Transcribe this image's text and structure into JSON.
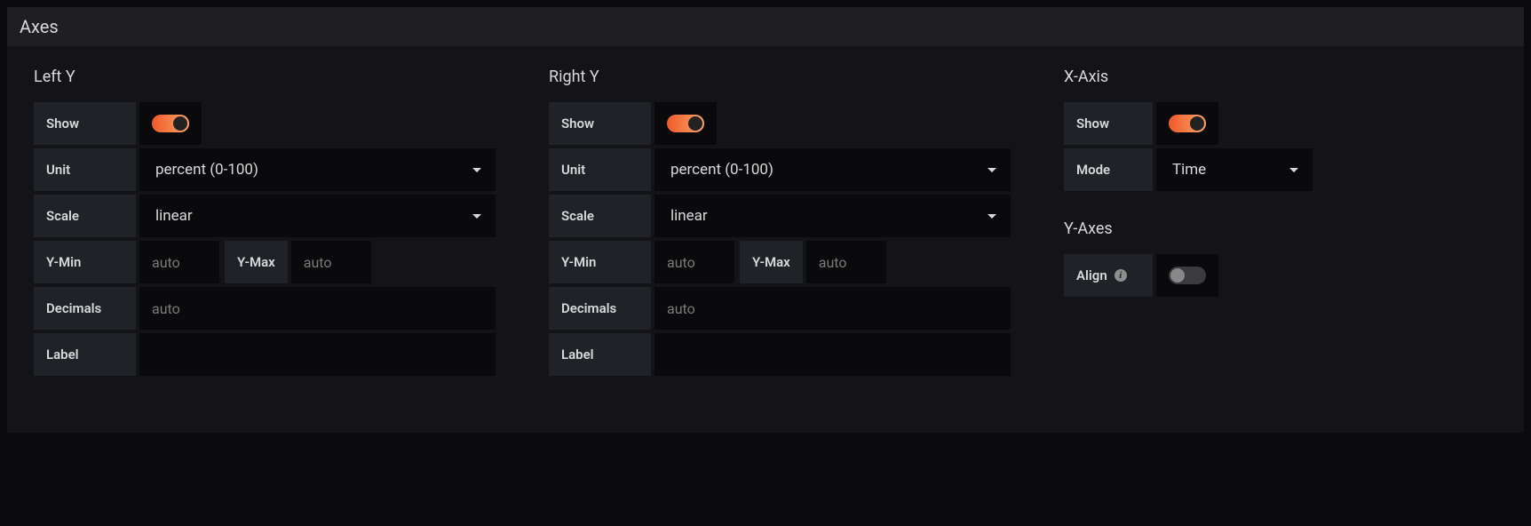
{
  "panel": {
    "title": "Axes"
  },
  "leftY": {
    "title": "Left Y",
    "show_label": "Show",
    "show_on": true,
    "unit_label": "Unit",
    "unit_value": "percent (0-100)",
    "scale_label": "Scale",
    "scale_value": "linear",
    "ymin_label": "Y-Min",
    "ymin_placeholder": "auto",
    "ymax_label": "Y-Max",
    "ymax_placeholder": "auto",
    "decimals_label": "Decimals",
    "decimals_placeholder": "auto",
    "label_label": "Label",
    "label_value": ""
  },
  "rightY": {
    "title": "Right Y",
    "show_label": "Show",
    "show_on": true,
    "unit_label": "Unit",
    "unit_value": "percent (0-100)",
    "scale_label": "Scale",
    "scale_value": "linear",
    "ymin_label": "Y-Min",
    "ymin_placeholder": "auto",
    "ymax_label": "Y-Max",
    "ymax_placeholder": "auto",
    "decimals_label": "Decimals",
    "decimals_placeholder": "auto",
    "label_label": "Label",
    "label_value": ""
  },
  "xAxis": {
    "title": "X-Axis",
    "show_label": "Show",
    "show_on": true,
    "mode_label": "Mode",
    "mode_value": "Time"
  },
  "yAxes": {
    "title": "Y-Axes",
    "align_label": "Align",
    "align_on": false
  }
}
